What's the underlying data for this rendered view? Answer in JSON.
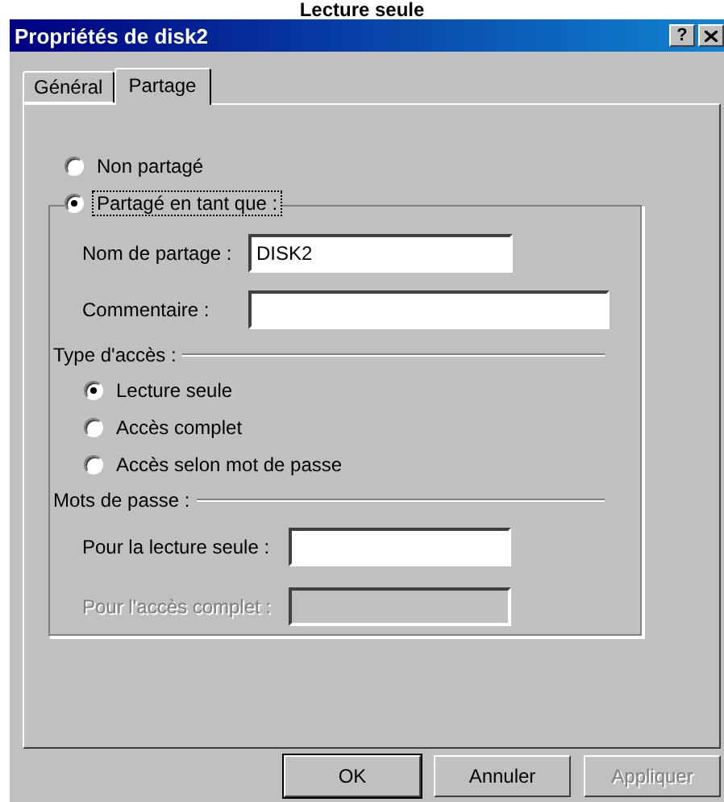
{
  "heading": "Lecture seule",
  "window": {
    "title": "Propriétés de disk2",
    "help": "?"
  },
  "tabs": [
    {
      "label": "Général",
      "selected": false
    },
    {
      "label": "Partage",
      "selected": true
    }
  ],
  "sharing": [
    {
      "label": "Non partagé",
      "selected": false,
      "focused": false
    },
    {
      "label": "Partagé en tant que :",
      "selected": true,
      "focused": true
    }
  ],
  "share_fields": [
    {
      "label": "Nom de partage :",
      "value": "DISK2"
    },
    {
      "label": "Commentaire :"
    }
  ],
  "access_type": {
    "title": "Type d'accès :",
    "options": [
      {
        "label": "Lecture seule",
        "selected": true
      },
      {
        "label": "Accès complet",
        "selected": false
      },
      {
        "label": "Accès selon mot de passe",
        "selected": false
      }
    ]
  },
  "passwords": {
    "title": "Mots de passe :",
    "fields": [
      {
        "label": "Pour la lecture seule :",
        "disabled": false
      },
      {
        "label": "Pour l'accès complet :",
        "disabled": true
      }
    ]
  },
  "buttons": [
    {
      "label": "OK",
      "default": true,
      "disabled": false
    },
    {
      "label": "Annuler",
      "default": false,
      "disabled": false
    },
    {
      "label": "Appliquer",
      "default": false,
      "disabled": true
    }
  ]
}
